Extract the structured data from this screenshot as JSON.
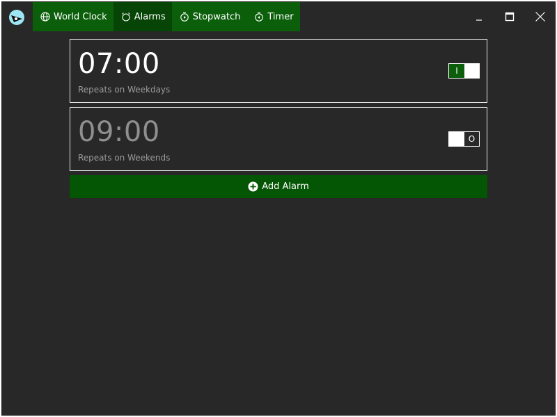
{
  "header": {
    "tabs": [
      {
        "label": "World Clock",
        "icon": "globe-icon",
        "active": false
      },
      {
        "label": "Alarms",
        "icon": "alarm-clock-icon",
        "active": true
      },
      {
        "label": "Stopwatch",
        "icon": "stopwatch-icon",
        "active": false
      },
      {
        "label": "Timer",
        "icon": "timer-icon",
        "active": false
      }
    ],
    "window_controls": [
      "minimize-icon",
      "maximize-icon",
      "close-icon"
    ]
  },
  "alarms": [
    {
      "time": "07:00",
      "repeat": "Repeats on Weekdays",
      "enabled": true,
      "toggle_label": "I"
    },
    {
      "time": "09:00",
      "repeat": "Repeats on Weekends",
      "enabled": false,
      "toggle_label": "O"
    }
  ],
  "add_alarm": {
    "label": "Add Alarm",
    "icon": "plus-circle-icon"
  },
  "colors": {
    "background": "#282828",
    "tab_bar": "#0b5f0b",
    "tab_active": "#074507",
    "add_button": "#045504",
    "card_border": "#e6e6e6",
    "text_muted": "#9a9a9a"
  }
}
